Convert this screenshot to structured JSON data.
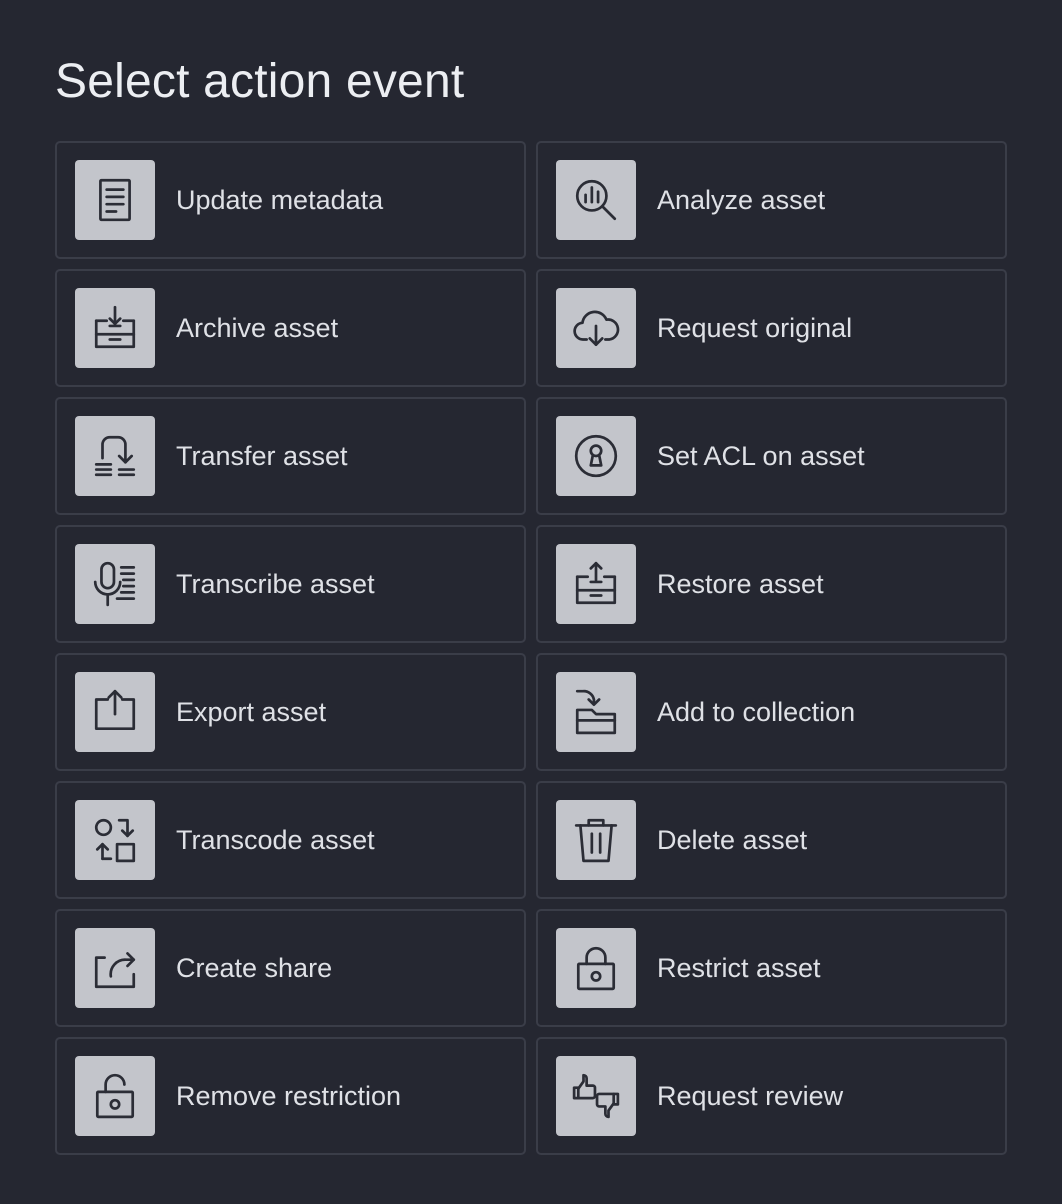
{
  "title": "Select action event",
  "actions": [
    {
      "label": "Update metadata",
      "icon": "document-icon"
    },
    {
      "label": "Analyze asset",
      "icon": "search-chart-icon"
    },
    {
      "label": "Archive asset",
      "icon": "archive-box-icon"
    },
    {
      "label": "Request original",
      "icon": "cloud-download-icon"
    },
    {
      "label": "Transfer asset",
      "icon": "transfer-icon"
    },
    {
      "label": "Set ACL on asset",
      "icon": "keyhole-icon"
    },
    {
      "label": "Transcribe asset",
      "icon": "microphone-text-icon"
    },
    {
      "label": "Restore asset",
      "icon": "restore-box-icon"
    },
    {
      "label": "Export asset",
      "icon": "export-icon"
    },
    {
      "label": "Add to collection",
      "icon": "folder-add-icon"
    },
    {
      "label": "Transcode asset",
      "icon": "transcode-icon"
    },
    {
      "label": "Delete asset",
      "icon": "trash-icon"
    },
    {
      "label": "Create share",
      "icon": "share-icon"
    },
    {
      "label": "Restrict asset",
      "icon": "lock-icon"
    },
    {
      "label": "Remove restriction",
      "icon": "unlock-icon"
    },
    {
      "label": "Request review",
      "icon": "thumbs-up-down-icon"
    }
  ],
  "colors": {
    "background": "#252731",
    "card_border": "#3a3d48",
    "icon_tile": "#c3c5cb",
    "icon_stroke": "#2b2d36",
    "text": "#dfe1e6"
  }
}
